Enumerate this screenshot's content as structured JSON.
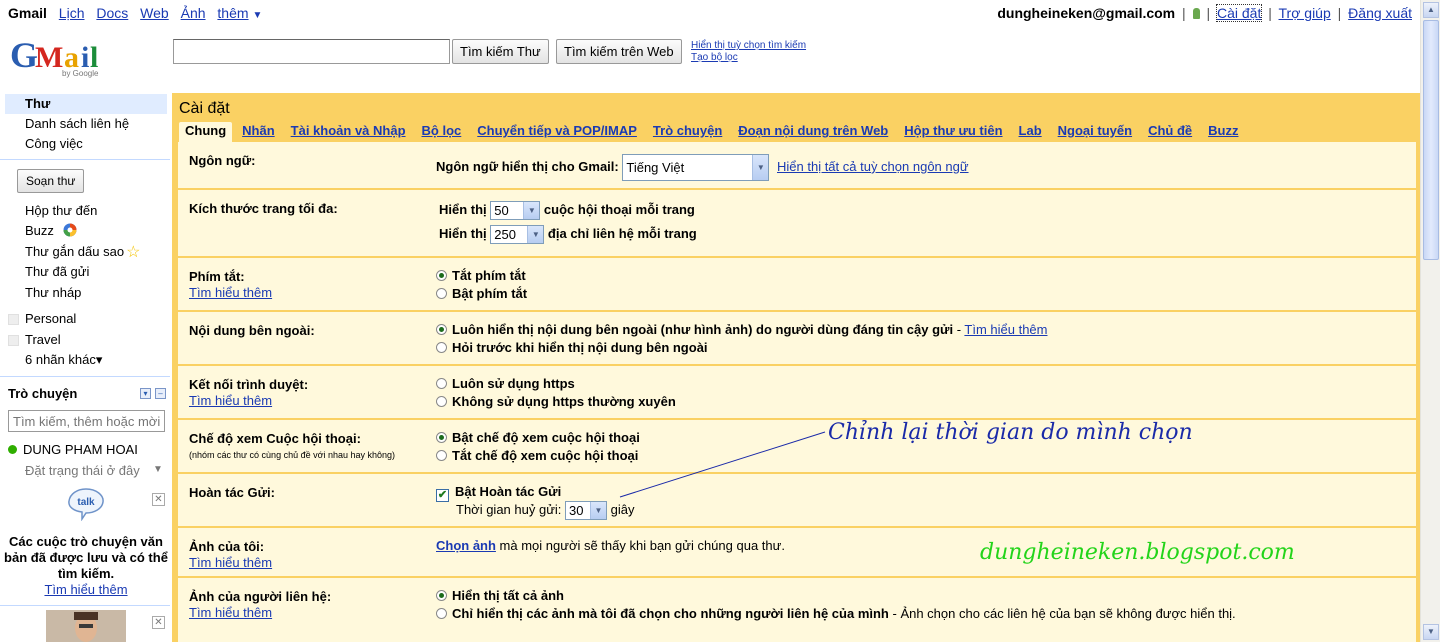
{
  "topnav": {
    "brand": "Gmail",
    "links": [
      "Lịch",
      "Docs",
      "Web",
      "Ảnh"
    ],
    "more": "thêm",
    "caret": "▼"
  },
  "topright": {
    "email": "dungheineken@gmail.com",
    "settings": "Cài đặt",
    "help": "Trợ giúp",
    "logout": "Đăng xuất",
    "sep": "|"
  },
  "logo": {
    "text": "GMail",
    "by": "by Google"
  },
  "search": {
    "value": "",
    "search_mail": "Tìm kiếm Thư",
    "search_web": "Tìm kiếm trên Web",
    "options_link": "Hiển thị tuỳ chọn tìm kiếm",
    "filter_link": "Tạo bộ lọc"
  },
  "leftnav": {
    "top_items": [
      "Thư",
      "Danh sách liên hệ",
      "Công việc"
    ],
    "compose": "Soạn thư",
    "folders": [
      "Hộp thư đến",
      "Buzz",
      "Thư gắn dấu sao",
      "Thư đã gửi",
      "Thư nháp"
    ],
    "labels": [
      "Personal",
      "Travel"
    ],
    "more_labels": "6 nhãn khác▾"
  },
  "chat": {
    "title": "Trò chuyện",
    "search_placeholder": "Tìm kiếm, thêm hoặc mời",
    "user": "DUNG PHAM HOAI",
    "status": "Đặt trạng thái ở đây",
    "status_caret": "▼",
    "talk_label": "talk",
    "close": "✕",
    "note": "Các cuộc trò chuyện văn bản đã được lưu và có thể tìm kiếm.",
    "learn_more": "Tìm hiểu thêm"
  },
  "panel": {
    "title": "Cài đặt",
    "tabs": [
      "Chung",
      "Nhãn",
      "Tài khoản và Nhập",
      "Bộ lọc",
      "Chuyển tiếp và POP/IMAP",
      "Trò chuyện",
      "Đoạn nội dung trên Web",
      "Hộp thư ưu tiên",
      "Lab",
      "Ngoại tuyến",
      "Chủ đề",
      "Buzz"
    ],
    "active_tab": "Chung"
  },
  "settings": {
    "language": {
      "label": "Ngôn ngữ:",
      "text": "Ngôn ngữ hiển thị cho Gmail:",
      "value": "Tiếng Việt",
      "link": "Hiển thị tất cả tuỳ chọn ngôn ngữ"
    },
    "page_size": {
      "label": "Kích thước trang tối đa:",
      "show": "Hiển thị",
      "conv_value": "50",
      "conv_text": "cuộc hội thoại mỗi trang",
      "contacts_value": "250",
      "contacts_text": "địa chỉ liên hệ mỗi trang"
    },
    "shortcuts": {
      "label": "Phím tắt:",
      "learn": "Tìm hiểu thêm",
      "off": "Tắt phím tắt",
      "on": "Bật phím tắt",
      "selected": "off"
    },
    "external": {
      "label": "Nội dung bên ngoài:",
      "always": "Luôn hiển thị nội dung bên ngoài (như hình ảnh) do người dùng đáng tin cậy gửi",
      "dash": " - ",
      "learn": "Tìm hiểu thêm",
      "ask": "Hỏi trước khi hiển thị nội dung bên ngoài",
      "selected": "always"
    },
    "browser": {
      "label": "Kết nối trình duyệt:",
      "learn": "Tìm hiểu thêm",
      "always": "Luôn sử dụng https",
      "never": "Không sử dụng https thường xuyên",
      "selected": "none"
    },
    "conversation": {
      "label": "Chế độ xem Cuộc hội thoại:",
      "sub": "(nhóm các thư có cùng chủ đề với nhau hay không)",
      "on": "Bật chế độ xem cuộc hội thoại",
      "off": "Tắt chế độ xem cuộc hội thoại",
      "selected": "on"
    },
    "undo": {
      "label": "Hoàn tác Gửi:",
      "enable": "Bật Hoàn tác Gửi",
      "checked": true,
      "check_mark": "✔",
      "period_label": "Thời gian huỷ gửi:",
      "period_value": "30",
      "unit": "giây"
    },
    "picture": {
      "label": "Ảnh của tôi:",
      "learn": "Tìm hiểu thêm",
      "choose": "Chọn ảnh",
      "text": " mà mọi người sẽ thấy khi bạn gửi chúng qua thư."
    },
    "contact_pics": {
      "label": "Ảnh của người liên hệ:",
      "learn": "Tìm hiểu thêm",
      "all": "Hiển thị tất cả ảnh",
      "mine": "Chỉ hiển thị các ảnh mà tôi đã chọn cho những người liên hệ của mình",
      "mine_note": " - Ảnh chọn cho các liên hệ của bạn sẽ không được hiển thị.",
      "selected": "all"
    }
  },
  "annotation": {
    "text": "Chỉnh lại thời gian do mình chọn"
  },
  "watermark": {
    "text": "dungheineken.blogspot.com"
  },
  "colors": {
    "panel": "#fad163",
    "content": "#fff9dc",
    "link": "#1a3ab3",
    "annotation": "#1a2aa8",
    "watermark": "#23d41a"
  }
}
